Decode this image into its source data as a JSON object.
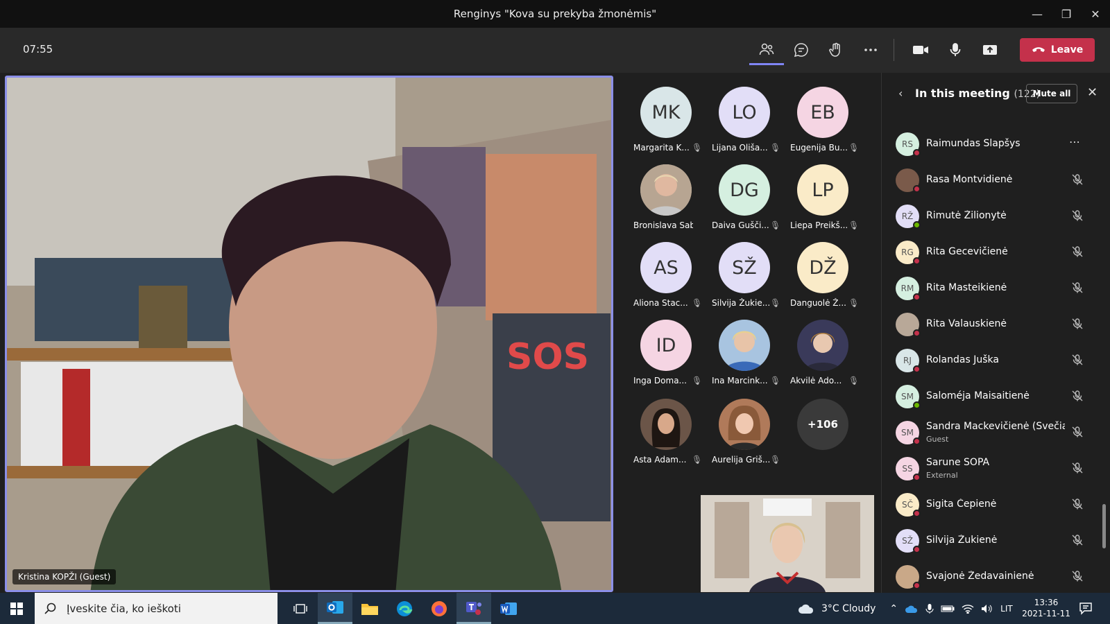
{
  "window": {
    "title": "Renginys \"Kova su prekyba žmonėmis\""
  },
  "toolbar": {
    "timer": "07:55",
    "leave_label": "Leave"
  },
  "main_video": {
    "name": "Kristina KOPŽI (Guest)"
  },
  "grid": {
    "participants": [
      {
        "initials": "MK",
        "name": "Margarita K...",
        "color": "#d9e6e8"
      },
      {
        "initials": "LO",
        "name": "Lijana Oliša...",
        "color": "#e2def7"
      },
      {
        "initials": "EB",
        "name": "Eugenija Bu...",
        "color": "#f5d5e3"
      },
      {
        "initials": "",
        "name": "Bronislava Sabi...",
        "color": "#c9b8a4"
      },
      {
        "initials": "DG",
        "name": "Daiva Gušči...",
        "color": "#d5efe0"
      },
      {
        "initials": "LP",
        "name": "Liepa Preikš...",
        "color": "#faebc8"
      },
      {
        "initials": "AS",
        "name": "Aliona Stac...",
        "color": "#e2def7"
      },
      {
        "initials": "SŽ",
        "name": "Silvija Žukie...",
        "color": "#e2def7"
      },
      {
        "initials": "DŽ",
        "name": "Danguolė Ž...",
        "color": "#faebc8"
      },
      {
        "initials": "ID",
        "name": "Inga Doma...",
        "color": "#f5d5e3"
      },
      {
        "initials": "",
        "name": "Ina Marcink...",
        "color": "#8fb0d0"
      },
      {
        "initials": "",
        "name": "Akvilė Ado...",
        "color": "#6a6a8a"
      },
      {
        "initials": "",
        "name": "Asta Adam...",
        "color": "#6b5548"
      },
      {
        "initials": "",
        "name": "Aurelija Griš...",
        "color": "#b07a5a"
      }
    ],
    "more_count": "+106"
  },
  "panel": {
    "title": "In this meeting",
    "count": "(122)",
    "mute_all": "Mute all",
    "people": [
      {
        "initials": "RS",
        "name": "Raimundas Slapšys",
        "sub": "",
        "color": "#d5efe0",
        "status": "#c4314b"
      },
      {
        "initials": "",
        "name": "Rasa Montvidienė",
        "sub": "",
        "color": "#7a5a4a",
        "status": "#c4314b"
      },
      {
        "initials": "RŽ",
        "name": "Rimutė Žilionytė",
        "sub": "",
        "color": "#e2def7",
        "status": "#6bb700"
      },
      {
        "initials": "RG",
        "name": "Rita Gecevičienė",
        "sub": "",
        "color": "#faebc8",
        "status": "#c4314b"
      },
      {
        "initials": "RM",
        "name": "Rita Masteikienė",
        "sub": "",
        "color": "#d5efe0",
        "status": "#c4314b"
      },
      {
        "initials": "",
        "name": "Rita Valauskienė",
        "sub": "",
        "color": "#b8a898",
        "status": "#c4314b"
      },
      {
        "initials": "RJ",
        "name": "Rolandas Juška",
        "sub": "",
        "color": "#d9e6e8",
        "status": "#c4314b"
      },
      {
        "initials": "SM",
        "name": "Saloméja Maisaitienė",
        "sub": "",
        "color": "#d5efe0",
        "status": "#6bb700"
      },
      {
        "initials": "SM",
        "name": "Sandra Mackevičienė (Svečias...",
        "sub": "Guest",
        "color": "#f5d5e3",
        "status": "#c4314b"
      },
      {
        "initials": "SS",
        "name": "Sarune SOPA",
        "sub": "External",
        "color": "#f5d5e3",
        "status": "#c4314b"
      },
      {
        "initials": "SČ",
        "name": "Sigita Čepienė",
        "sub": "",
        "color": "#faebc8",
        "status": "#c4314b"
      },
      {
        "initials": "SŽ",
        "name": "Silvija Žukienė",
        "sub": "",
        "color": "#e2def7",
        "status": "#c4314b"
      },
      {
        "initials": "",
        "name": "Svajonė Žedavainienė",
        "sub": "",
        "color": "#c9a888",
        "status": "#c4314b"
      }
    ]
  },
  "taskbar": {
    "search_placeholder": "Įveskite čia, ko ieškoti",
    "weather": "3°C  Cloudy",
    "lang": "LIT",
    "time": "13:36",
    "date": "2021-11-11"
  }
}
